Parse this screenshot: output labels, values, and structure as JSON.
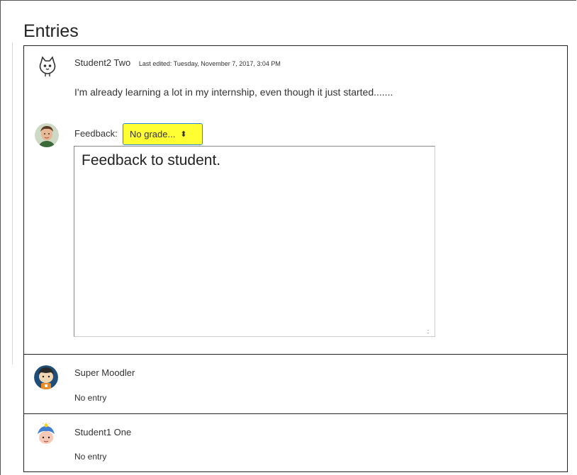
{
  "page": {
    "title": "Entries"
  },
  "entries": [
    {
      "author": "Student2 Two",
      "meta": "Last edited: Tuesday, November 7, 2017, 3:04 PM",
      "text": "I'm already learning a lot in my internship, even though it just started.......",
      "avatar_icon": "cat-icon",
      "feedback": {
        "label": "Feedback:",
        "grade_selected": "No grade...",
        "grade_caret": "⬍",
        "text": "Feedback to student.",
        "grader_avatar_icon": "teacher-avatar-icon"
      }
    },
    {
      "author": "Super Moodler",
      "status": "No entry",
      "avatar_icon": "moodler-avatar-icon"
    },
    {
      "author": "Student1 One",
      "status": "No entry",
      "avatar_icon": "student-avatar-icon"
    }
  ],
  "colors": {
    "grade_select_bg": "#ffff33",
    "grade_select_border": "#2a86d6",
    "border": "#222222"
  }
}
